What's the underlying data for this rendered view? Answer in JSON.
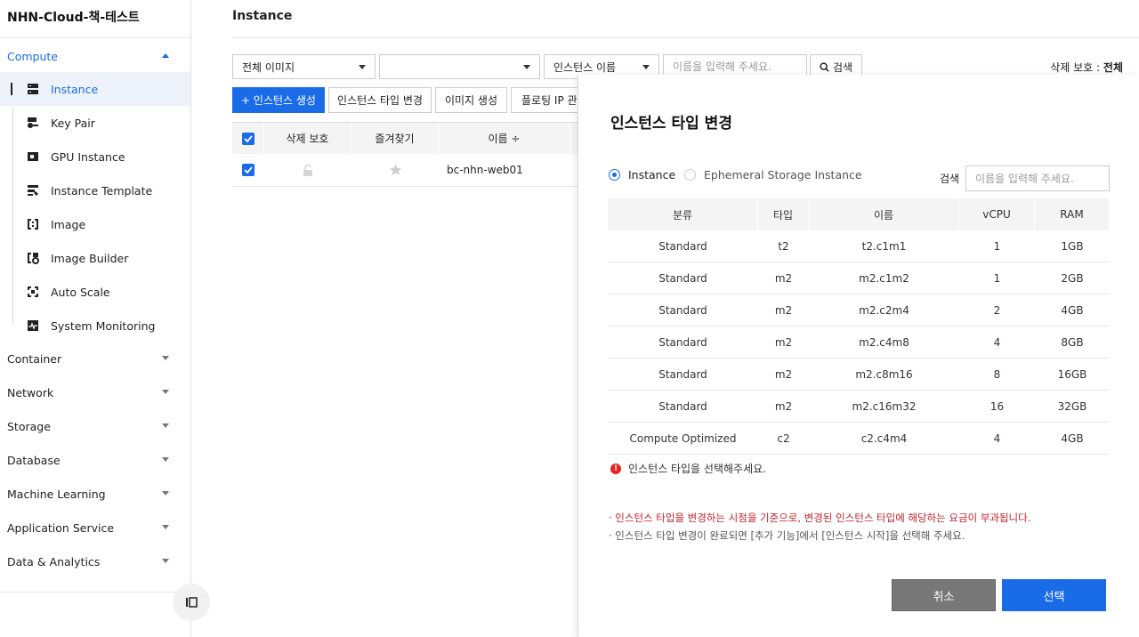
{
  "project": "NHN-Cloud-책-테스트",
  "nav": {
    "compute": "Compute",
    "sub_items": [
      "Instance",
      "Key Pair",
      "GPU Instance",
      "Instance Template",
      "Image",
      "Image Builder",
      "Auto Scale",
      "System Monitoring"
    ],
    "groups": [
      "Container",
      "Network",
      "Storage",
      "Database",
      "Machine Learning",
      "Application Service",
      "Data & Analytics"
    ]
  },
  "page": {
    "title": "Instance"
  },
  "filters": {
    "image_select": "전체 이미지",
    "second_select": "",
    "field_select": "인스턴스 이름",
    "search_placeholder": "이름을 입력해 주세요.",
    "search_button": "검색"
  },
  "delete_protect": {
    "label": "삭제 보호 :",
    "value": "전체"
  },
  "toolbar": {
    "create": "+  인스턴스 생성",
    "change_type": "인스턴스 타입 변경",
    "create_image": "이미지 생성",
    "floating_ip": "플로팅 IP 관리"
  },
  "grid": {
    "headers": {
      "delete_protect": "삭제 보호",
      "favorite": "즐겨찾기",
      "name": "이름 ÷"
    },
    "rows": [
      {
        "name": "bc-nhn-web01"
      }
    ]
  },
  "modal": {
    "title": "인스턴스 타입 변경",
    "radio_instance": "Instance",
    "radio_ephemeral": "Ephemeral Storage Instance",
    "search_label": "검색",
    "search_placeholder": "이름을 입력해 주세요.",
    "headers": [
      "분류",
      "타입",
      "이름",
      "vCPU",
      "RAM"
    ],
    "rows": [
      [
        "Standard",
        "t2",
        "t2.c1m1",
        "1",
        "1GB"
      ],
      [
        "Standard",
        "m2",
        "m2.c1m2",
        "1",
        "2GB"
      ],
      [
        "Standard",
        "m2",
        "m2.c2m4",
        "2",
        "4GB"
      ],
      [
        "Standard",
        "m2",
        "m2.c4m8",
        "4",
        "8GB"
      ],
      [
        "Standard",
        "m2",
        "m2.c8m16",
        "8",
        "16GB"
      ],
      [
        "Standard",
        "m2",
        "m2.c16m32",
        "16",
        "32GB"
      ],
      [
        "Compute Optimized",
        "c2",
        "c2.c4m4",
        "4",
        "4GB"
      ]
    ],
    "warning": "인스턴스 타입을 선택해주세요.",
    "note_red": "· 인스턴스 타입을 변경하는 시점을 기준으로, 변경된 인스턴스 타입에 해당하는 요금이 부과됩니다.",
    "note_gray": "· 인스턴스 타입 변경이 완료되면 [추가 기능]에서 [인스턴스 시작]을 선택해 주세요.",
    "cancel": "취소",
    "confirm": "선택"
  },
  "colors": {
    "accent": "#1a6be8",
    "error": "#e52323",
    "cancel_bg": "#777777"
  }
}
